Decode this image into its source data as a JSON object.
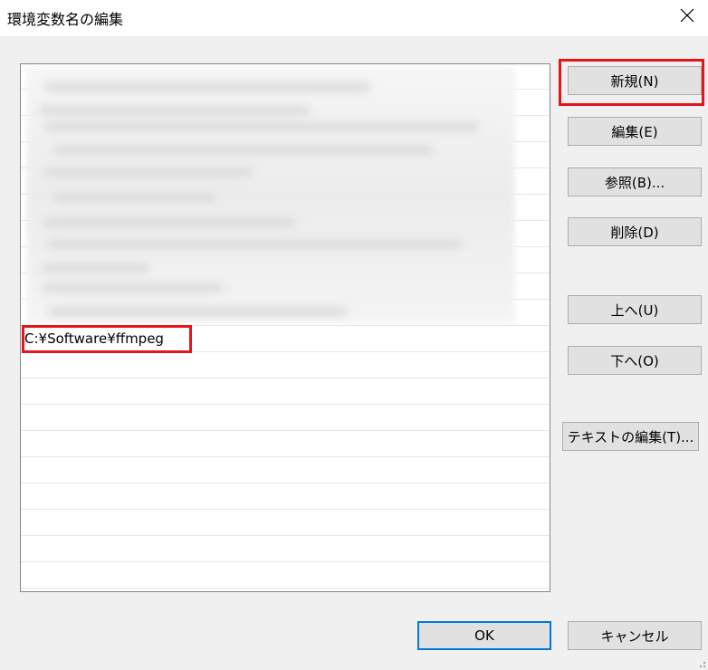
{
  "window": {
    "title": "環境変数名の編集",
    "close_icon": "close-icon"
  },
  "list": {
    "items": [
      {
        "text": "",
        "blurred": true
      },
      {
        "text": "",
        "blurred": true
      },
      {
        "text": "",
        "blurred": true
      },
      {
        "text": "",
        "blurred": true
      },
      {
        "text": "",
        "blurred": true
      },
      {
        "text": "",
        "blurred": true
      },
      {
        "text": "",
        "blurred": true
      },
      {
        "text": "",
        "blurred": true
      },
      {
        "text": "",
        "blurred": true
      },
      {
        "text": "",
        "blurred": true
      },
      {
        "text": "C:¥Software¥ffmpeg",
        "blurred": false
      },
      {
        "text": "",
        "blurred": false
      },
      {
        "text": "",
        "blurred": false
      },
      {
        "text": "",
        "blurred": false
      },
      {
        "text": "",
        "blurred": false
      },
      {
        "text": "",
        "blurred": false
      },
      {
        "text": "",
        "blurred": false
      },
      {
        "text": "",
        "blurred": false
      },
      {
        "text": "",
        "blurred": false
      },
      {
        "text": "",
        "blurred": false
      }
    ]
  },
  "buttons": {
    "new": "新規(N)",
    "edit": "編集(E)",
    "browse": "参照(B)...",
    "delete": "削除(D)",
    "move_up": "上へ(U)",
    "move_down": "下へ(O)",
    "edit_text": "テキストの編集(T)...",
    "ok": "OK",
    "cancel": "キャンセル"
  },
  "colors": {
    "highlight": "#e3161b",
    "default_button_border": "#0078d7"
  }
}
